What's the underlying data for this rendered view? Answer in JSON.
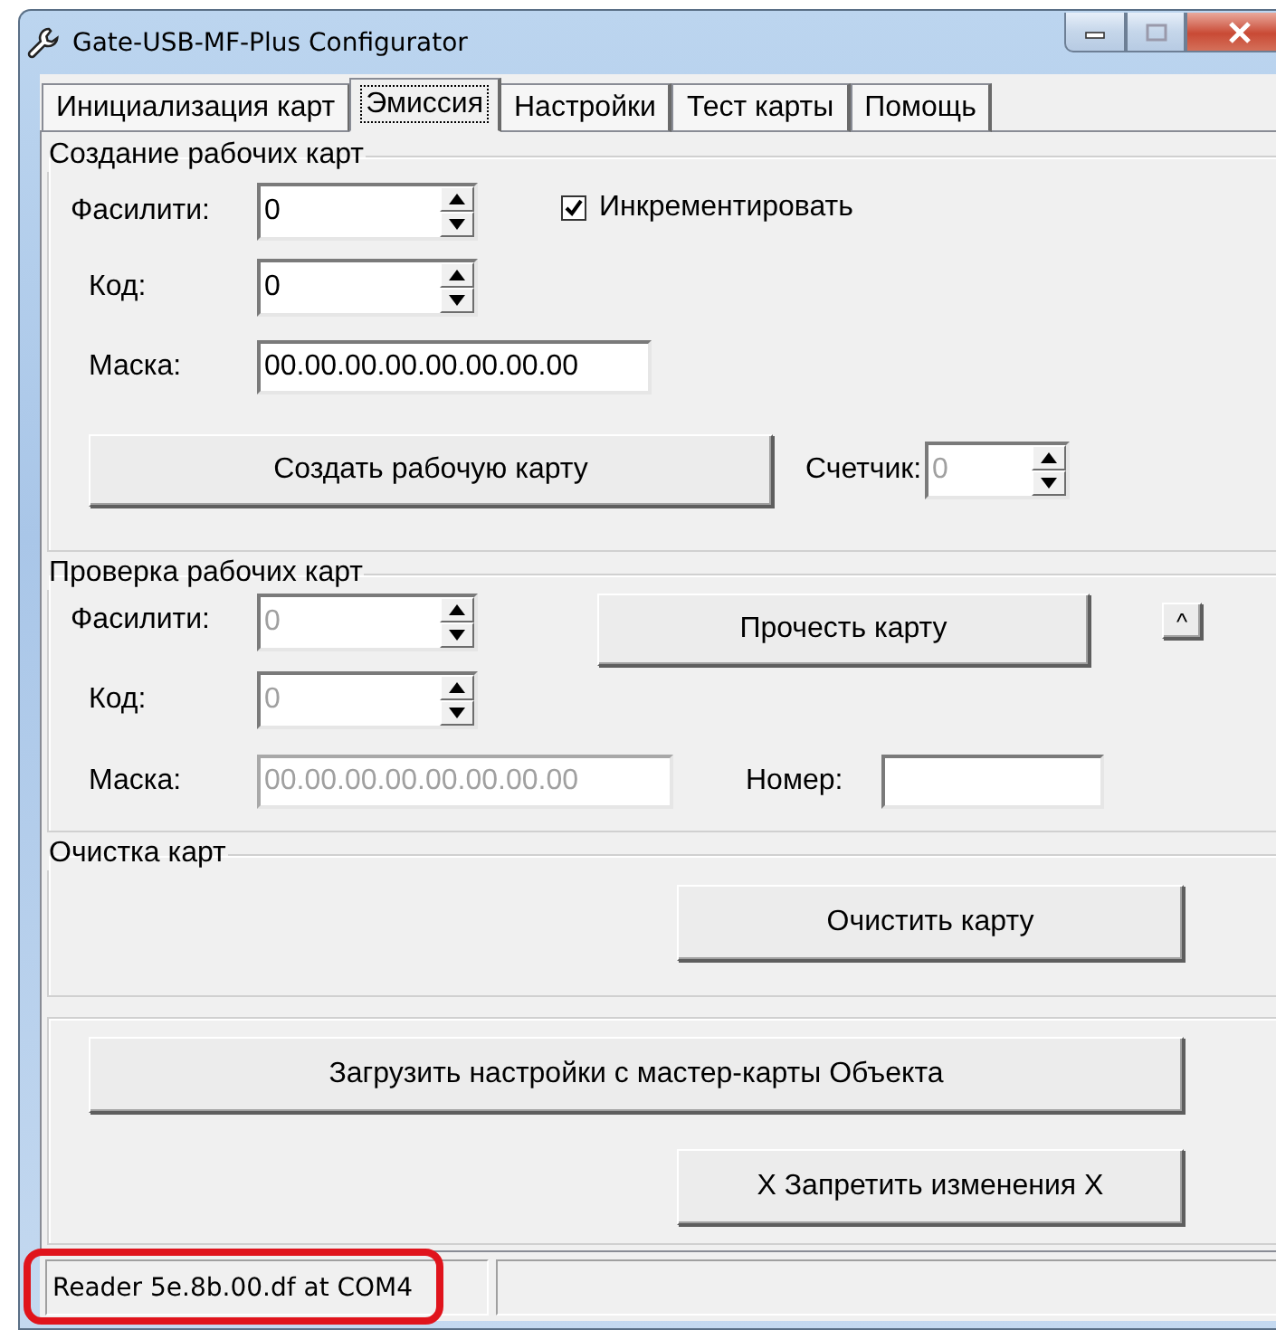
{
  "window": {
    "title": "Gate-USB-MF-Plus Configurator"
  },
  "tabs": [
    {
      "label": "Инициализация карт",
      "selected": false
    },
    {
      "label": "Эмиссия",
      "selected": true
    },
    {
      "label": "Настройки",
      "selected": false
    },
    {
      "label": "Тест карты",
      "selected": false
    },
    {
      "label": "Помощь",
      "selected": false
    }
  ],
  "creation": {
    "title": "Создание рабочих карт",
    "facility": {
      "label": "Фасилити:",
      "value": "0",
      "disabled": false
    },
    "code": {
      "label": "Код:",
      "value": "0",
      "disabled": false
    },
    "mask": {
      "label": "Маска:",
      "value": "00.00.00.00.00.00.00.00",
      "disabled": false
    },
    "increment": {
      "label": "Инкрементировать",
      "checked": true
    },
    "create_button": "Создать рабочую карту",
    "counter": {
      "label": "Счетчик:",
      "value": "0",
      "disabled": true
    }
  },
  "verification": {
    "title": "Проверка рабочих карт",
    "facility": {
      "label": "Фасилити:",
      "value": "0",
      "disabled": true
    },
    "code": {
      "label": "Код:",
      "value": "0",
      "disabled": true
    },
    "mask": {
      "label": "Маска:",
      "value": "00.00.00.00.00.00.00.00",
      "disabled": true
    },
    "read_button": "Прочесть карту",
    "small_button": "^",
    "number": {
      "label": "Номер:"
    }
  },
  "clearing": {
    "title": "Очистка карт",
    "clear_button": "Очистить карту"
  },
  "actions": {
    "load_button": "Загрузить настройки с мастер-карты Объекта",
    "lock_button": "X Запретить изменения X"
  },
  "status_bar": {
    "panels": [
      {
        "text": "Reader 5e.8b.00.df at COM4",
        "highlighted": true
      }
    ]
  }
}
